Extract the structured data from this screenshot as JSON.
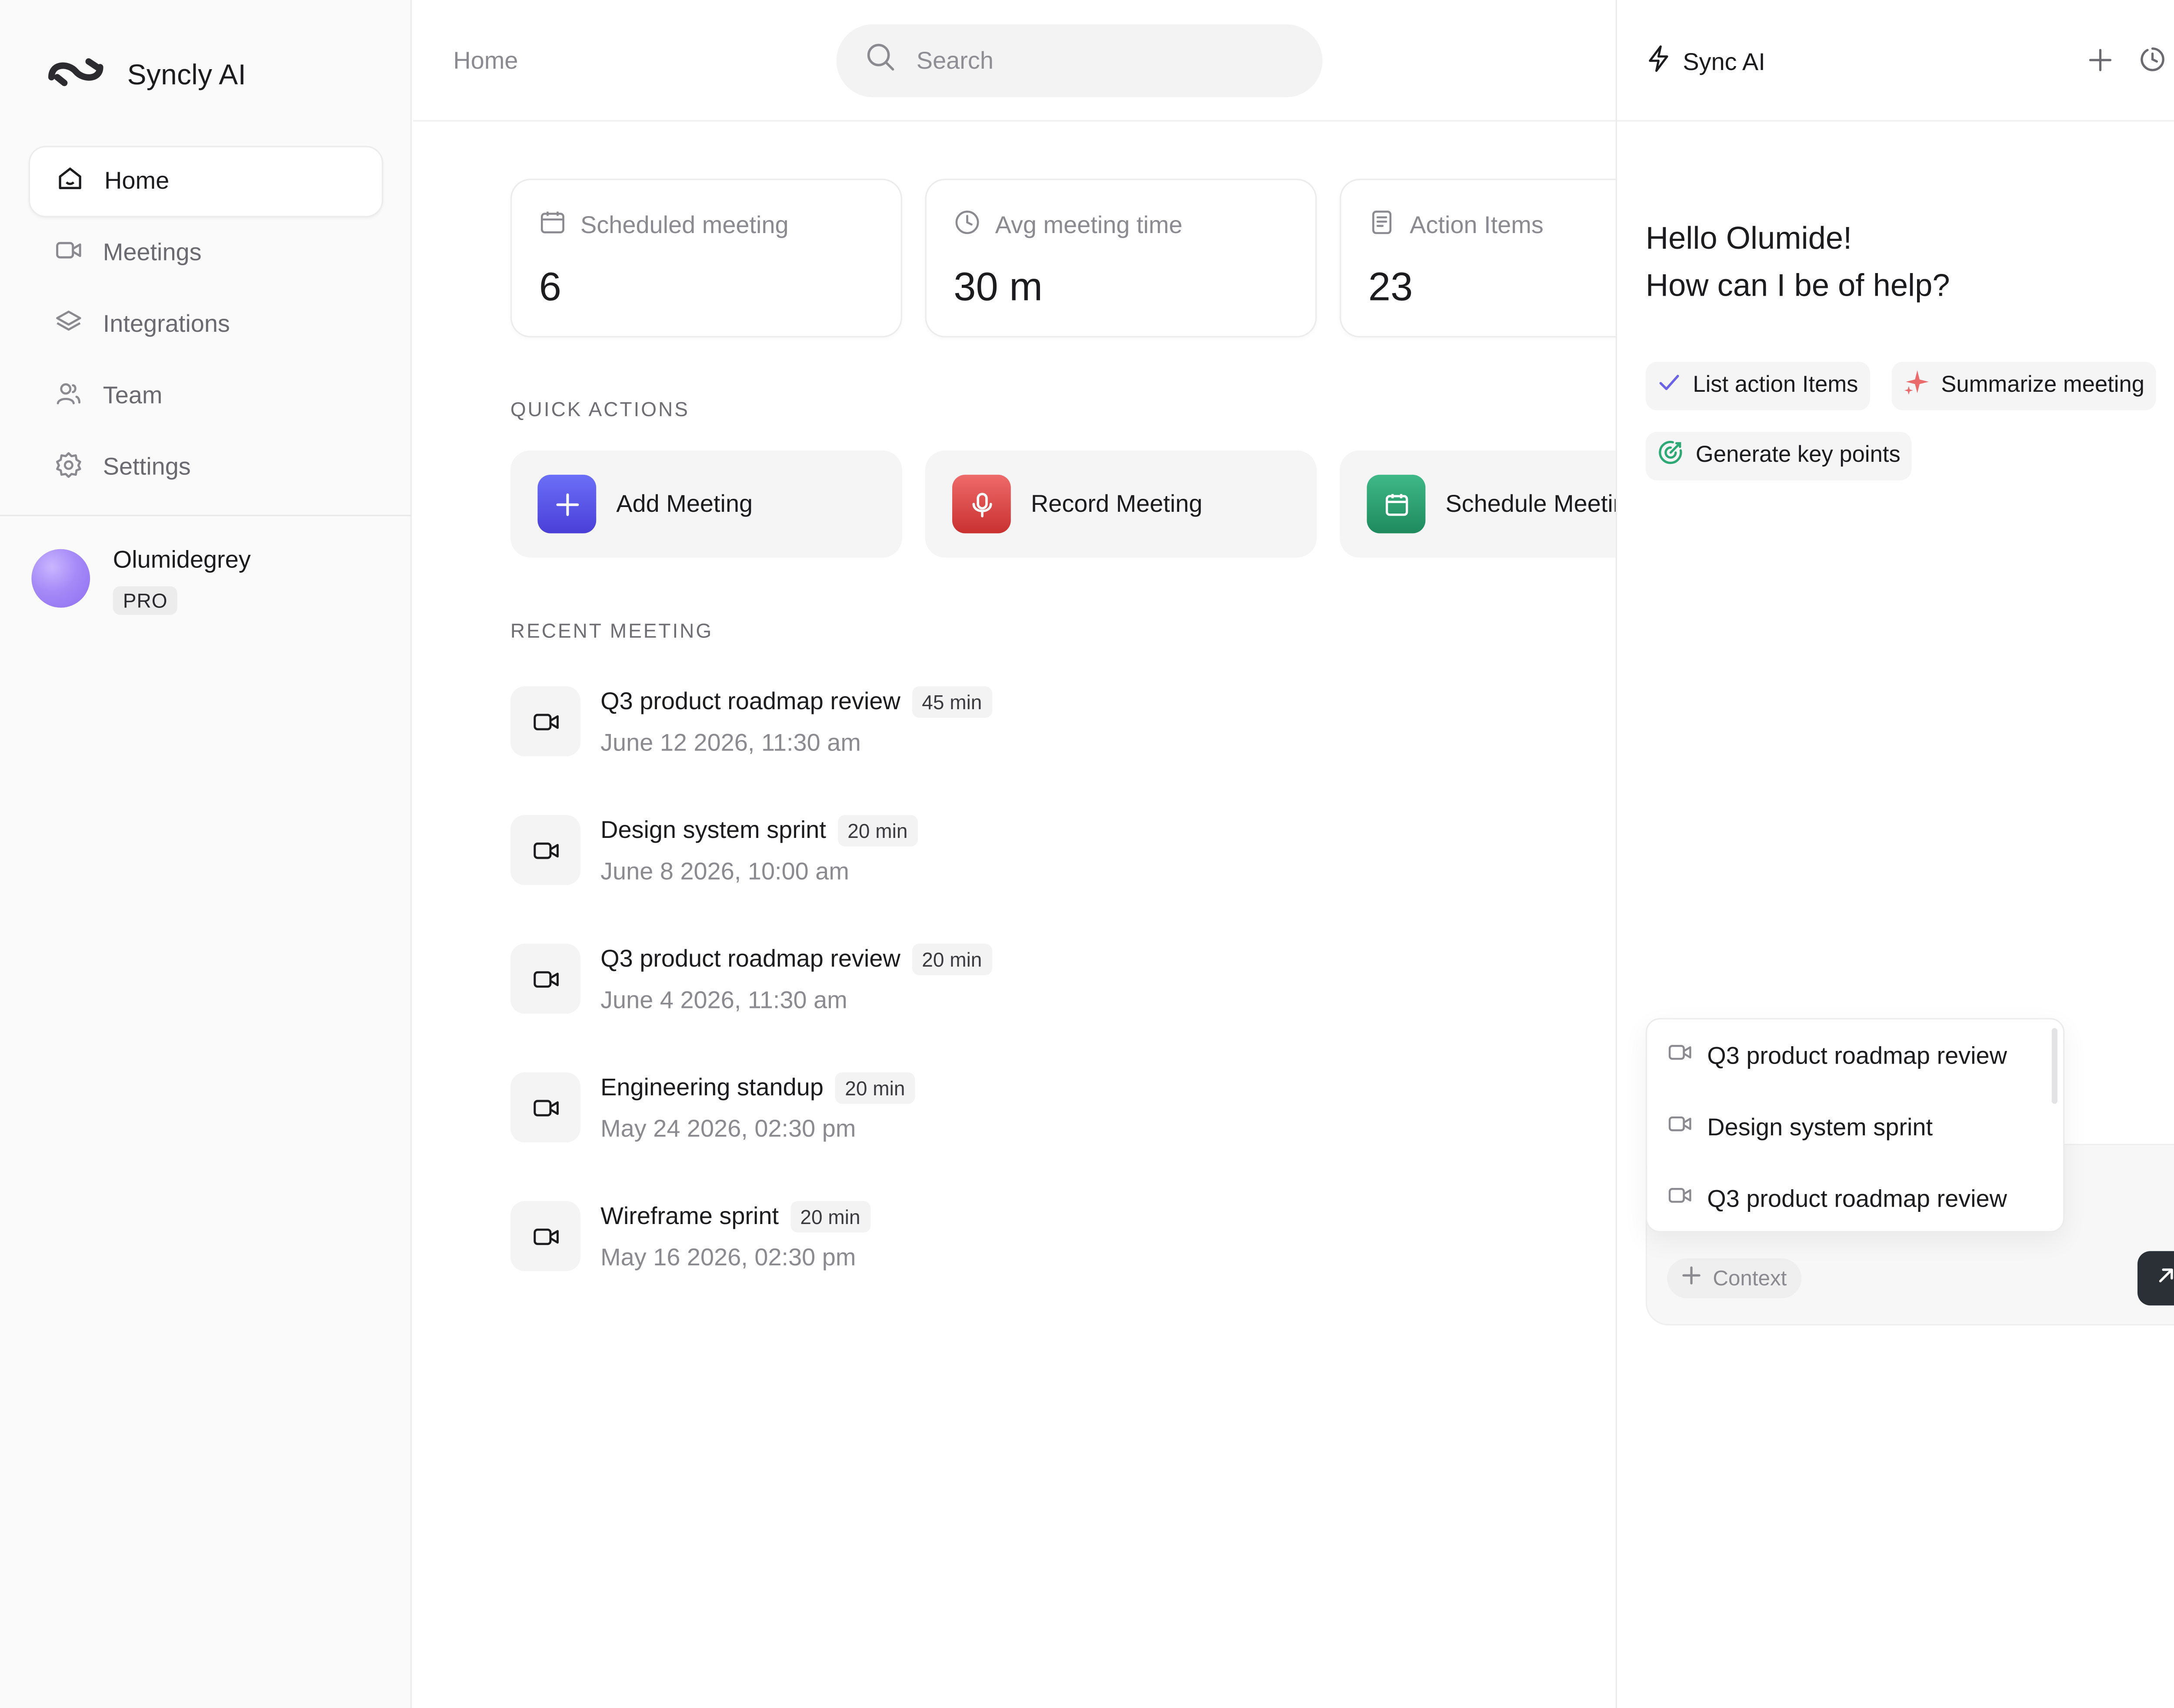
{
  "app": {
    "name": "Syncly AI"
  },
  "sidebar": {
    "items": [
      {
        "label": "Home",
        "icon": "home-icon",
        "active": true
      },
      {
        "label": "Meetings",
        "icon": "video-icon"
      },
      {
        "label": "Integrations",
        "icon": "layers-icon"
      },
      {
        "label": "Team",
        "icon": "users-icon"
      },
      {
        "label": "Settings",
        "icon": "gear-icon"
      }
    ],
    "user": {
      "name": "Olumidegrey",
      "plan": "PRO"
    }
  },
  "topbar": {
    "breadcrumb": "Home",
    "search_placeholder": "Search"
  },
  "stats": [
    {
      "label": "Scheduled meeting",
      "value": "6",
      "icon": "calendar-icon"
    },
    {
      "label": "Avg meeting time",
      "value": "30 m",
      "icon": "clock-icon"
    },
    {
      "label": "Action Items",
      "value": "23",
      "icon": "document-icon"
    }
  ],
  "quick_actions": {
    "title": "QUICK ACTIONS",
    "items": [
      {
        "label": "Add Meeting",
        "icon": "plus-icon",
        "color": "#5a55ea"
      },
      {
        "label": "Record Meeting",
        "icon": "microphone-icon",
        "color": "#dc4545"
      },
      {
        "label": "Schedule Meeting",
        "icon": "calendar-icon",
        "color": "#2a9d6e"
      }
    ]
  },
  "recent": {
    "title": "RECENT MEETING",
    "items": [
      {
        "title": "Q3 product roadmap review",
        "duration": "45 min",
        "date": "June 12 2026, 11:30 am"
      },
      {
        "title": "Design system sprint",
        "duration": "20 min",
        "date": "June 8 2026, 10:00 am"
      },
      {
        "title": "Q3 product roadmap review",
        "duration": "20 min",
        "date": "June 4 2026, 11:30 am"
      },
      {
        "title": "Engineering standup",
        "duration": "20 min",
        "date": "May 24 2026, 02:30 pm"
      },
      {
        "title": "Wireframe sprint",
        "duration": "20 min",
        "date": "May 16 2026, 02:30 pm"
      }
    ]
  },
  "assistant": {
    "title": "Sync AI",
    "greeting_line1": "Hello Olumide!",
    "greeting_line2": "How can I be of help?",
    "suggestions": [
      {
        "label": "List action Items",
        "icon": "check-icon"
      },
      {
        "label": "Summarize meeting",
        "icon": "sparkle-icon"
      },
      {
        "label": "Generate key points",
        "icon": "target-icon"
      }
    ],
    "context_options": [
      "Q3 product roadmap review",
      "Design system sprint",
      "Q3 product roadmap review"
    ],
    "context_button": "Context"
  }
}
